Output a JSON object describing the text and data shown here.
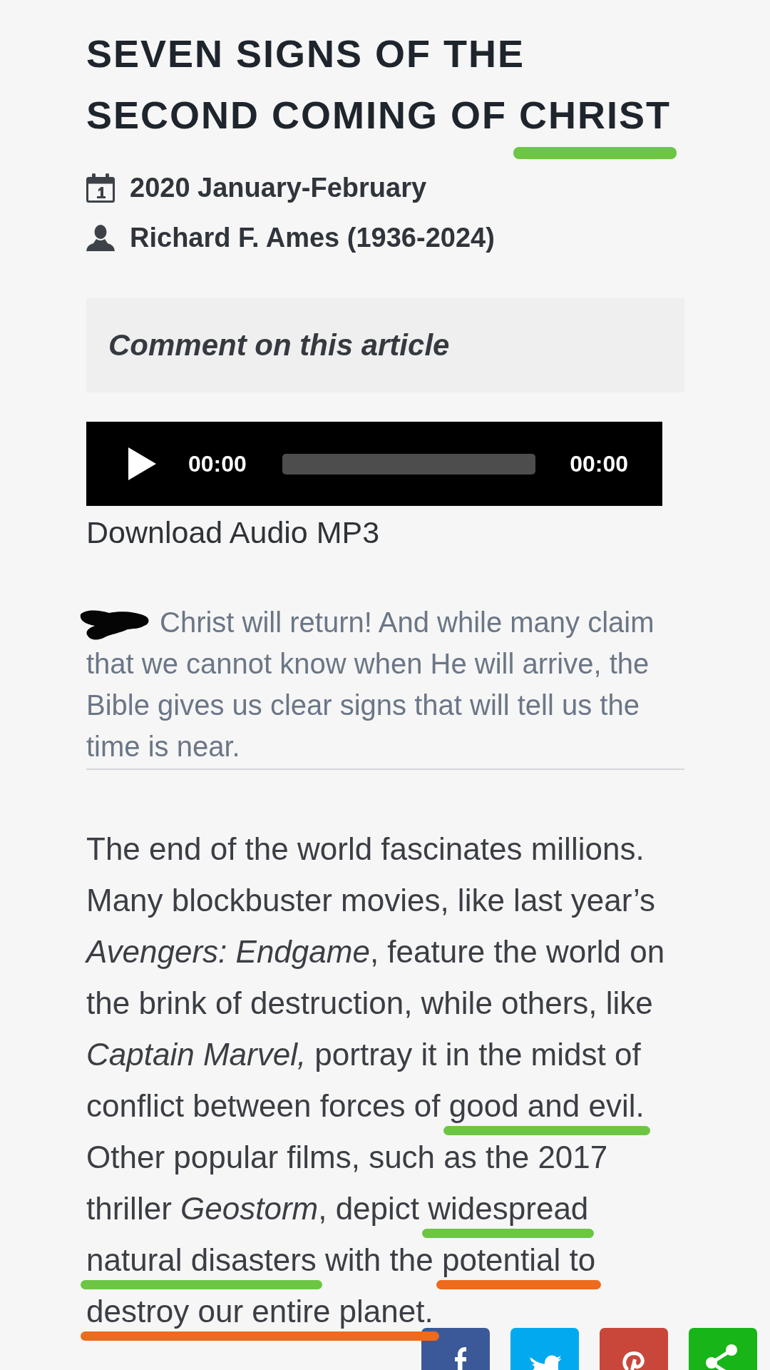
{
  "article": {
    "title": [
      {
        "text": "SEVEN SIGNS OF THE SECOND COMING OF "
      },
      {
        "text": "CHRIST",
        "color": "#6cc644"
      }
    ],
    "issue": "2020 January-February",
    "author": "Richard F. Ames (1936-2024)"
  },
  "comment_link": "Comment on this article",
  "audio_player": {
    "current_time": "00:00",
    "duration": "00:00"
  },
  "download_link": "Download Audio MP3",
  "summary": "Christ will return! And while many claim that we cannot know when He will arrive, the Bible gives us clear signs that will tell us the time is near.",
  "article_body": [
    {
      "text": "The end of the world fascinates millions. Many blockbuster movies, like last year’s *Avengers: Endgame*, feature the world on the brink of destruction, while others, like *Captain Marvel,* portray it in the midst of conflict between forces of "
    },
    {
      "text": "good and evil.",
      "color": "#6cc644"
    },
    {
      "text": " Other popular films, such as the 2017 thriller *Geostorm*, depict "
    },
    {
      "text": "widespread ",
      "color": "#6cc644"
    },
    {
      "text": "natural disasters",
      "color": "#6cc644"
    },
    {
      "text": " with the "
    },
    {
      "text": "potential to ",
      "color": "#ee6a1c"
    },
    {
      "text": "destroy our entire planet.",
      "color": "#ee6a1c"
    }
  ]
}
